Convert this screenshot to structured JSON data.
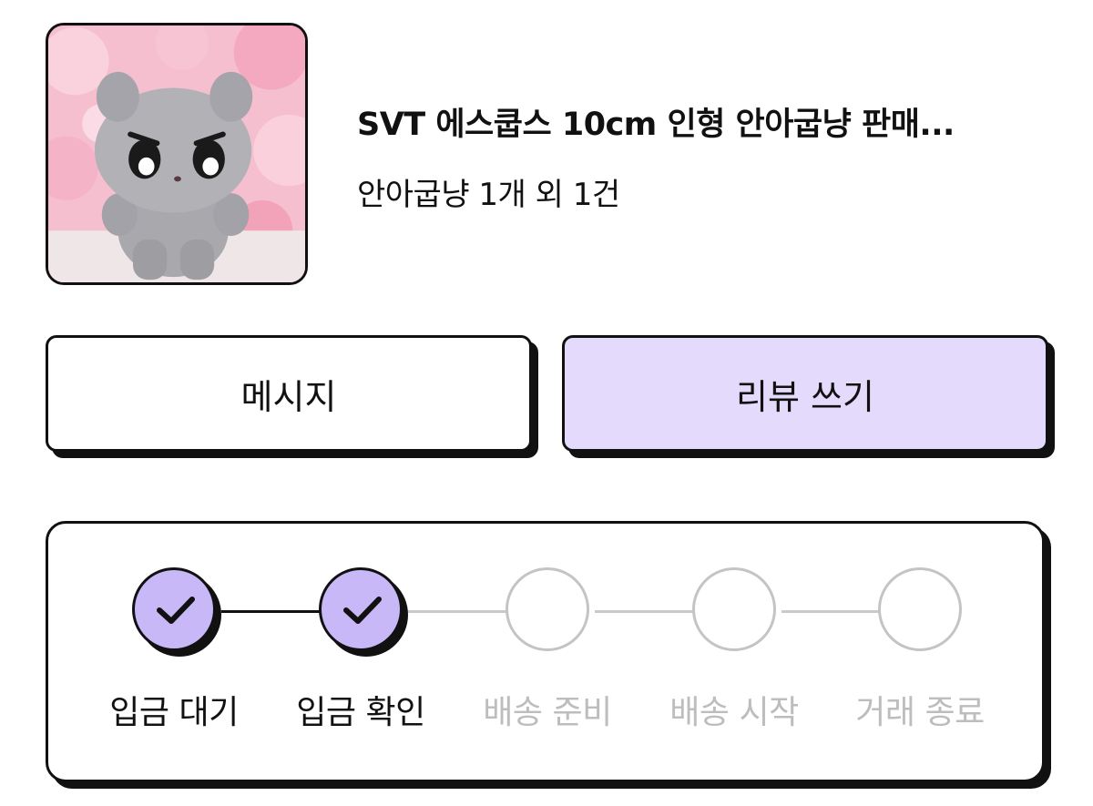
{
  "product": {
    "image_icon": "plush-doll-photo",
    "title": "SVT 에스쿱스 10cm 인형 안아굽냥 판매...",
    "summary": "안아굽냥 1개 외 1건"
  },
  "actions": {
    "message_label": "메시지",
    "review_label": "리뷰 쓰기"
  },
  "progress": {
    "steps": [
      {
        "label": "입금 대기",
        "status": "done"
      },
      {
        "label": "입금 확인",
        "status": "done"
      },
      {
        "label": "배송 준비",
        "status": "pending"
      },
      {
        "label": "배송 시작",
        "status": "pending"
      },
      {
        "label": "거래 종료",
        "status": "pending"
      }
    ]
  },
  "colors": {
    "accent_fill": "#c9b8f7",
    "review_button_bg": "#e3dafc",
    "pending_gray": "#bdbdbd",
    "outline": "#111111"
  }
}
